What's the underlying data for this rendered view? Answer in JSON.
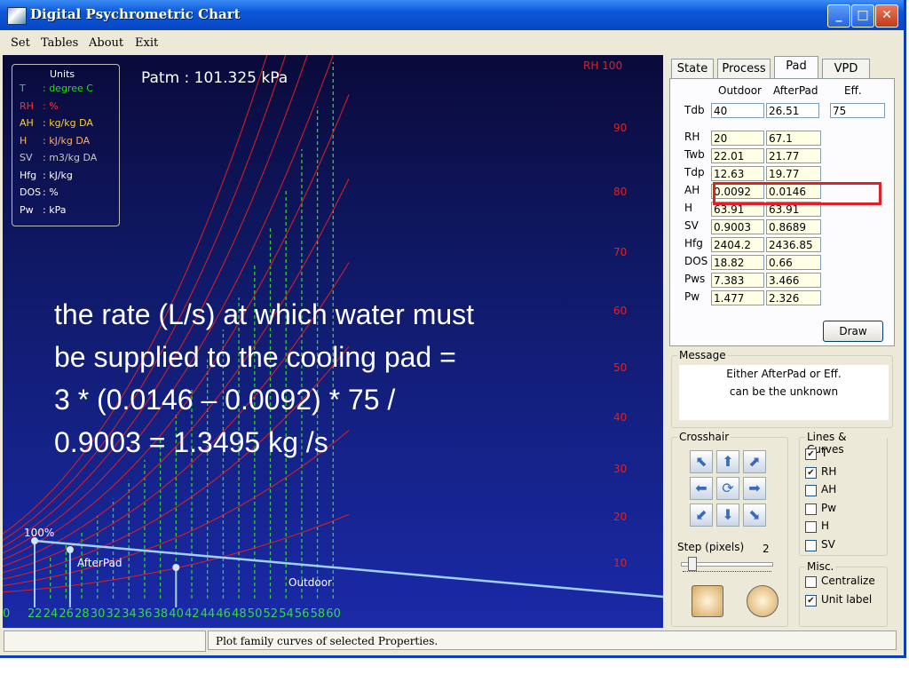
{
  "window": {
    "title": "Digital Psychrometric Chart"
  },
  "menu": [
    "Set",
    "Tables",
    "About",
    "Exit"
  ],
  "chart": {
    "patm": "Patm : 101.325  kPa",
    "units_title": "Units",
    "units": [
      {
        "key": "T",
        "text": ": degree C",
        "color": "#22dd22"
      },
      {
        "key": "RH",
        "text": ": %",
        "color": "#ff3030"
      },
      {
        "key": "AH",
        "text": ": kg/kg DA",
        "color": "#ffd21a"
      },
      {
        "key": "H",
        "text": ": kJ/kg DA",
        "color": "#ffb060"
      },
      {
        "key": "SV",
        "text": ": m3/kg DA",
        "color": "#c8c8c8"
      },
      {
        "key": "Hfg",
        "text": ": kJ/kg",
        "color": "#ffffff"
      },
      {
        "key": "DOS",
        "text": ": %",
        "color": "#ffffff"
      },
      {
        "key": "Pw",
        "text": ": kPa",
        "color": "#ffffff"
      }
    ],
    "x_ticks": [
      "22",
      "24",
      "26",
      "28",
      "30",
      "32",
      "34",
      "36",
      "38",
      "40",
      "42",
      "44",
      "46",
      "48",
      "50",
      "52",
      "54",
      "56",
      "58",
      "60"
    ],
    "x_first_tick": "0",
    "rh_labels": [
      "RH 100",
      "90",
      "80",
      "70",
      "60",
      "50",
      "40",
      "30",
      "20",
      "10"
    ],
    "point_labels": {
      "hundred": "100%",
      "afterpad": "AfterPad",
      "outdoor": "Outdoor"
    },
    "colors": {
      "rh_curve": "#e02020",
      "temp_line": "#33cc33",
      "process_line": "#9fd0ff",
      "background_top": "#0a0a3a",
      "background_bottom": "#1a2aa8"
    }
  },
  "overlay": {
    "line1": "the rate (L/s) at which water must",
    "line2": "be supplied to the cooling pad =",
    "line3": "3 * (0.0146 – 0.0092) * 75 /",
    "line4": "0.9003 = 1.3495 kg /s"
  },
  "tabs": [
    "State",
    "Process",
    "Pad",
    "VPD"
  ],
  "pad": {
    "col_outdoor": "Outdoor",
    "col_afterpad": "AfterPad",
    "col_eff": "Eff.",
    "tdb_label": "Tdb",
    "tdb_outdoor": "40",
    "tdb_afterpad": "26.51",
    "eff": "75",
    "rows": [
      {
        "label": "RH",
        "outdoor": "20",
        "afterpad": "67.1"
      },
      {
        "label": "Twb",
        "outdoor": "22.01",
        "afterpad": "21.77"
      },
      {
        "label": "Tdp",
        "outdoor": "12.63",
        "afterpad": "19.77"
      },
      {
        "label": "AH",
        "outdoor": "0.0092",
        "afterpad": "0.0146"
      },
      {
        "label": "H",
        "outdoor": "63.91",
        "afterpad": "63.91"
      },
      {
        "label": "SV",
        "outdoor": "0.9003",
        "afterpad": "0.8689"
      },
      {
        "label": "Hfg",
        "outdoor": "2404.2",
        "afterpad": "2436.85"
      },
      {
        "label": "DOS",
        "outdoor": "18.82",
        "afterpad": "0.66"
      },
      {
        "label": "Pws",
        "outdoor": "7.383",
        "afterpad": "3.466"
      },
      {
        "label": "Pw",
        "outdoor": "1.477",
        "afterpad": "2.326"
      }
    ],
    "draw_button": "Draw"
  },
  "message": {
    "title": "Message",
    "line1": "Either AfterPad or Eff.",
    "line2": "can be the unknown"
  },
  "crosshair": {
    "title": "Crosshair",
    "step_label": "Step (pixels)",
    "step_value": "2"
  },
  "lines_curves": {
    "title": "Lines & Curves",
    "items": [
      {
        "label": "T",
        "checked": true
      },
      {
        "label": "RH",
        "checked": true
      },
      {
        "label": "AH",
        "checked": false
      },
      {
        "label": "Pw",
        "checked": false
      },
      {
        "label": "H",
        "checked": false
      },
      {
        "label": "SV",
        "checked": false
      }
    ]
  },
  "misc": {
    "title": "Misc.",
    "items": [
      {
        "label": "Centralize",
        "checked": false
      },
      {
        "label": "Unit label",
        "checked": true
      }
    ]
  },
  "status": {
    "text": "Plot family curves of selected Properties."
  }
}
